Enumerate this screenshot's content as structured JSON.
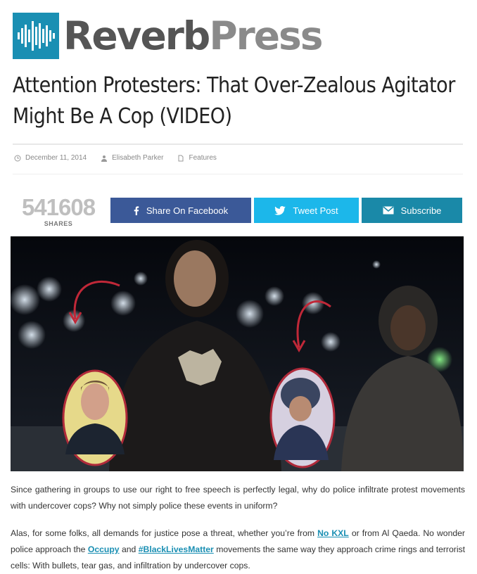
{
  "site": {
    "logo_word1": "Reverb",
    "logo_word2": "Press",
    "accent_color": "#1a8fb3"
  },
  "article": {
    "title_line1": "Attention Protesters: That Over-Zealous Agitator",
    "title_line2": "Might Be A Cop (VIDEO)",
    "date": "December 11, 2014",
    "author": "Elisabeth Parker",
    "category": "Features"
  },
  "share": {
    "count": "541608",
    "count_label": "SHARES",
    "facebook_label": "Share On Facebook",
    "twitter_label": "Tweet Post",
    "subscribe_label": "Subscribe",
    "facebook_color": "#3b5998",
    "twitter_color": "#1cb7ea",
    "subscribe_color": "#1a89a8"
  },
  "body": {
    "p1": "Since gathering in groups to use our right to free speech is perfectly legal, why do police infiltrate protest movements with undercover cops? Why not simply police these events in uniform?",
    "p2_a": "Alas, for some folks, all demands for justice pose a threat, whether you’re from ",
    "p2_link1": "No KXL",
    "p2_b": " or from Al Qaeda. No wonder police approach the ",
    "p2_link2": "Occupy",
    "p2_c": " and ",
    "p2_link3": "#BlackLivesMatter",
    "p2_d": " movements the same way they approach crime rings and terrorist cells: With bullets, tear gas, and infiltration by undercover cops."
  }
}
